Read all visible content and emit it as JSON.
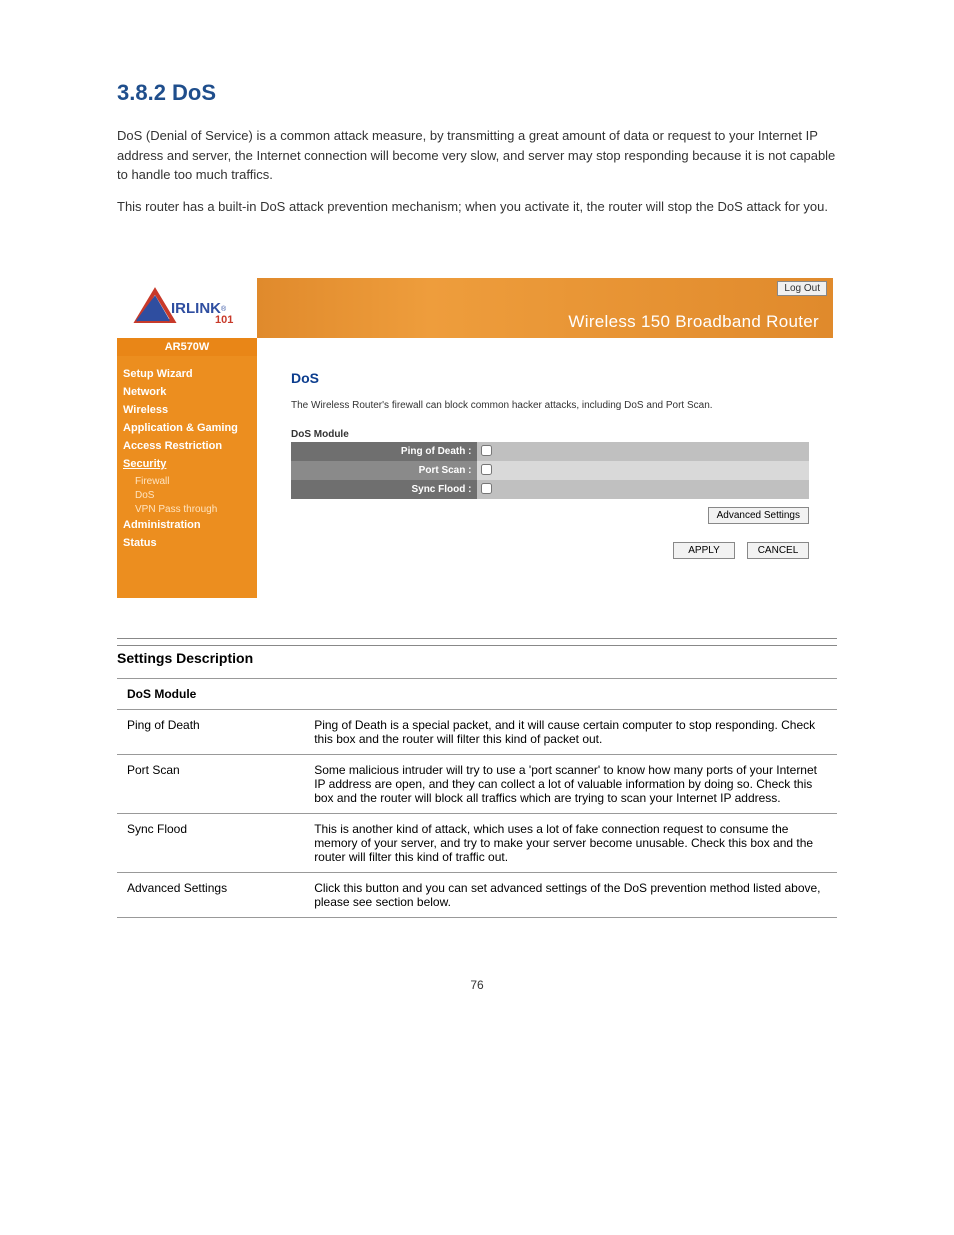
{
  "doc": {
    "heading": "3.8.2 DoS",
    "intro_1": "DoS (Denial of Service) is a common attack measure, by transmitting a great amount of data or request to your Internet IP address and server, the Internet connection will become very slow, and server may stop responding because it is not capable to handle too much traffics.",
    "intro_2": "This router has a built-in DoS attack prevention mechanism; when you activate it, the router will stop the DoS attack for you.",
    "settings_heading": "Settings Description",
    "table_header_1": "DoS Module",
    "table_header_2": "",
    "rows": [
      {
        "label": "Ping of Death",
        "desc": "Ping of Death is a special packet, and it will cause certain computer to stop responding. Check this box and the router will filter this kind of packet out."
      },
      {
        "label": "Port Scan",
        "desc": "Some malicious intruder will try to use a 'port scanner' to know how many ports of your Internet IP address are open, and they can collect a lot of valuable information by doing so. Check this box and the router will block all traffics which are trying to scan your Internet IP address."
      },
      {
        "label": "Sync Flood",
        "desc": "This is another kind of attack, which uses a lot of fake connection request to consume the memory of your server, and try to make your server become unusable. Check this box and the router will filter this kind of traffic out."
      },
      {
        "label": "Advanced Settings",
        "desc": "Click this button and you can set advanced settings of the DoS prevention method listed above, please see section below."
      }
    ],
    "page_number": "76"
  },
  "router": {
    "logout": "Log Out",
    "title": "Wireless 150 Broadband Router",
    "model": "AR570W",
    "nav": [
      "Setup Wizard",
      "Network",
      "Wireless",
      "Application & Gaming",
      "Access Restriction",
      "Security",
      "Administration",
      "Status"
    ],
    "sub_nav": [
      "Firewall",
      "DoS",
      "VPN Pass through"
    ],
    "content": {
      "title": "DoS",
      "desc": "The Wireless Router's firewall can block common hacker attacks, including DoS and Port Scan.",
      "module_label": "DoS Module",
      "rows": [
        {
          "label": "Ping of Death :"
        },
        {
          "label": "Port Scan :"
        },
        {
          "label": "Sync Flood :"
        }
      ],
      "advanced": "Advanced Settings",
      "apply": "APPLY",
      "cancel": "CANCEL"
    }
  }
}
